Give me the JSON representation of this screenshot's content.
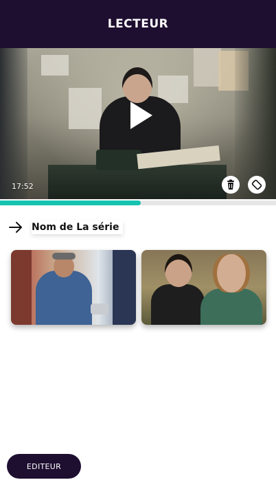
{
  "header": {
    "title": "LECTEUR"
  },
  "player": {
    "duration": "17:52",
    "progress_percent": 51,
    "icons": {
      "play": "play-icon",
      "delete": "trash-icon",
      "rotate": "rotate-screen-icon"
    }
  },
  "series": {
    "name": "Nom de La série",
    "icon": "arrow-right-icon"
  },
  "episodes": [
    {
      "thumbnail": "episode-thumbnail-1"
    },
    {
      "thumbnail": "episode-thumbnail-2"
    }
  ],
  "footer": {
    "editor_label": "EDITEUR"
  },
  "colors": {
    "header_bg": "#1e0e30",
    "accent": "#15c3b0",
    "button_bg": "#1e0e30"
  }
}
